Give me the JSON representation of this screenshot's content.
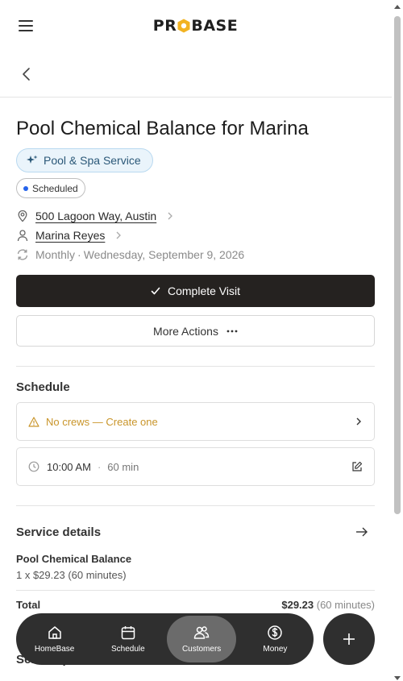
{
  "header": {
    "logo_text_left": "PR",
    "logo_text_right": "BASE"
  },
  "job": {
    "title": "Pool Chemical Balance for Marina",
    "service_tag": "Pool & Spa Service",
    "status": "Scheduled",
    "address": "500 Lagoon Way, Austin",
    "customer": "Marina Reyes",
    "recurrence": "Monthly",
    "separator": "·",
    "date": "Wednesday, September 9, 2026"
  },
  "actions": {
    "complete_label": "Complete Visit",
    "more_label": "More Actions"
  },
  "schedule": {
    "title": "Schedule",
    "crew_warning": "No crews — Create one",
    "time": "10:00 AM",
    "dot": "·",
    "duration": "60 min"
  },
  "service_details": {
    "title": "Service details",
    "item_name": "Pool Chemical Balance",
    "item_meta": "1 x $29.23 (60 minutes)",
    "total_label": "Total",
    "total_amount": "$29.23",
    "total_duration": "(60 minutes)",
    "next_section_partial": "Service p"
  },
  "nav": {
    "items": [
      {
        "label": "HomeBase",
        "icon": "home-icon"
      },
      {
        "label": "Schedule",
        "icon": "calendar-icon"
      },
      {
        "label": "Customers",
        "icon": "users-icon",
        "active": true
      },
      {
        "label": "Money",
        "icon": "dollar-icon"
      }
    ]
  },
  "colors": {
    "primary_button": "#252220",
    "tag_bg": "#eaf4fb",
    "tag_text": "#2b5878",
    "status_dot": "#2563eb",
    "warning": "#c9952a",
    "nav_bg": "#2f2f2f",
    "nav_active": "#6b6b6b"
  }
}
